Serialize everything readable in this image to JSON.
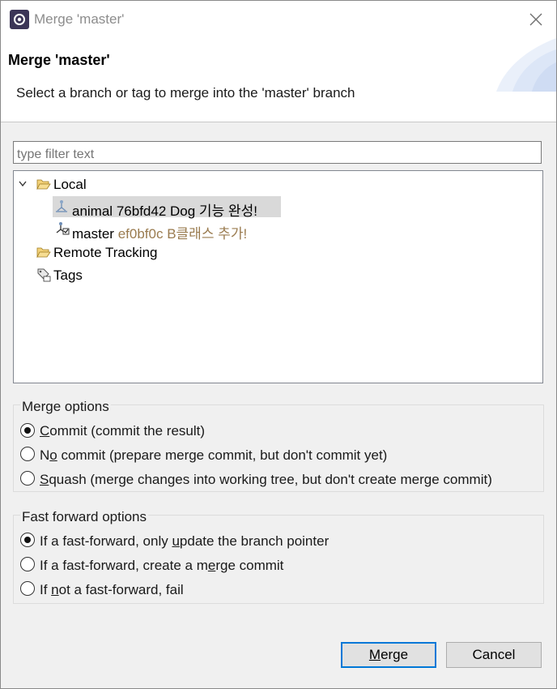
{
  "window": {
    "title": "Merge 'master'"
  },
  "banner": {
    "title": "Merge 'master'",
    "description": "Select a branch or tag to merge into the 'master' branch"
  },
  "filter": {
    "placeholder": "type filter text"
  },
  "tree": {
    "local": {
      "label": "Local"
    },
    "branches": [
      {
        "name": "animal",
        "commit": "76bfd42",
        "message": "Dog 기능 완성!"
      },
      {
        "name": "master",
        "commit": "ef0bf0c",
        "message": "B클래스 추가!"
      }
    ],
    "remote": {
      "label": "Remote Tracking"
    },
    "tags": {
      "label": "Tags"
    }
  },
  "merge_options": {
    "title": "Merge options",
    "commit": {
      "mn": "C",
      "rest": "ommit (commit the result)"
    },
    "no_commit": {
      "pre": "N",
      "mn": "o",
      "rest": " commit (prepare merge commit, but don't commit yet)"
    },
    "squash": {
      "mn": "S",
      "rest": "quash (merge changes into working tree, but don't create merge commit)"
    },
    "selected": "commit"
  },
  "ff_options": {
    "title": "Fast forward options",
    "ff_only": {
      "pre": "If a fast-forward, only ",
      "mn": "u",
      "rest": "pdate the branch pointer"
    },
    "ff_merge": {
      "pre": "If a fast-forward, create a m",
      "mn": "e",
      "rest": "rge commit"
    },
    "no_ff": {
      "pre": "If ",
      "mn": "n",
      "rest": "ot a fast-forward, fail"
    },
    "selected": "ff_only"
  },
  "buttons": {
    "merge": {
      "mn": "M",
      "rest": "erge"
    },
    "cancel": "Cancel"
  },
  "colors": {
    "accent": "#0078d7",
    "commit_text": "#9a7b4f"
  }
}
